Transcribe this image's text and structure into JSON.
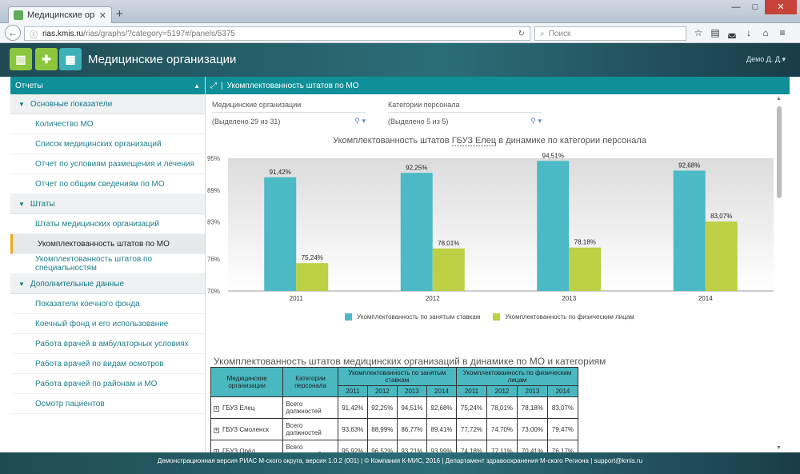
{
  "browser": {
    "tab_title": "Медицинские организации",
    "url_domain": "rias.kmis.ru",
    "url_path": "/rias/graphs/?category=5197#/panels/5375",
    "search_placeholder": "Поиск"
  },
  "app": {
    "title": "Медицинские организации",
    "user": "Демо Д. Д."
  },
  "sidebar": {
    "header": "Отчеты",
    "sections": [
      {
        "label": "Основные показатели",
        "items": [
          "Количество МО",
          "Список медицинских организаций",
          "Отчет по условиям размещения и лечения",
          "Отчет по общим сведениям по МО"
        ]
      },
      {
        "label": "Штаты",
        "items": [
          "Штаты медицинских организаций",
          "Укомплектованность штатов по МО",
          "Укомплектованность штатов по специальностям"
        ]
      },
      {
        "label": "Дополнительные данные",
        "items": [
          "Показатели коечного фонда",
          "Коечный фонд и его использование",
          "Работа врачей в амбулаторных условиях",
          "Работа врачей по видам осмотров",
          "Работа врачей по районам и МО",
          "Осмотр пациентов"
        ]
      }
    ]
  },
  "panel": {
    "title": "Укомплектованность штатов по МО",
    "filters": [
      {
        "label": "Медицинские организации",
        "value": "(Выделено 29 из 31)"
      },
      {
        "label": "Категории персонала",
        "value": "(Выделено 5 из 5)"
      }
    ]
  },
  "chart": {
    "title_before": "Укомплектованность штатов ",
    "title_link": "ГБУЗ Елец",
    "title_after": " в динамике по категории персонала"
  },
  "chart_data": {
    "type": "bar",
    "categories": [
      "2011",
      "2012",
      "2013",
      "2014"
    ],
    "series": [
      {
        "name": "Укомплектованность по занятым ставкам",
        "values": [
          91.42,
          92.25,
          94.51,
          92.68
        ],
        "labels": [
          "91,42%",
          "92,25%",
          "94,51%",
          "92,68%"
        ],
        "color": "#4bb9c6"
      },
      {
        "name": "Укомплектованность по физическим лицам",
        "values": [
          75.24,
          78.01,
          78.18,
          83.07
        ],
        "labels": [
          "75,24%",
          "78,01%",
          "78,18%",
          "83,07%"
        ],
        "color": "#bccf45"
      }
    ],
    "ylim": [
      70,
      95
    ],
    "yticks": [
      70,
      76,
      83,
      89,
      95
    ],
    "ytick_labels": [
      "70%",
      "76%",
      "83%",
      "89%",
      "95%"
    ],
    "grid": false,
    "legend": "bottom"
  },
  "table": {
    "title": "Укомплектованность штатов медицинских организаций в динамике по МО и категориям",
    "col_mo": "Медицинские организации",
    "col_cat": "Категории персонала",
    "group1": "Укомплектованность по занятым ставкам",
    "group2": "Укомплектованность по физическим лицам",
    "years": [
      "2011",
      "2012",
      "2013",
      "2014",
      "2011",
      "2012",
      "2013",
      "2014"
    ],
    "rows": [
      {
        "mo": "ГБУЗ Елец",
        "cat": "Всего должностей",
        "values": [
          "91,42%",
          "92,25%",
          "94,51%",
          "92,68%",
          "75,24%",
          "78,01%",
          "78,18%",
          "83,07%"
        ]
      },
      {
        "mo": "ГБУЗ Смоленск",
        "cat": "Всего должностей",
        "values": [
          "93,63%",
          "88,99%",
          "86,77%",
          "89,41%",
          "77,72%",
          "74,70%",
          "73,00%",
          "79,47%"
        ]
      },
      {
        "mo": "ГБУЗ Орёл",
        "cat": "Всего должностей",
        "values": [
          "95,92%",
          "96,52%",
          "93,21%",
          "93,99%",
          "74,18%",
          "77,11%",
          "70,41%",
          "76,17%"
        ]
      }
    ]
  },
  "footer": "Демонстрационная версия РИАС М-ского округа, версия 1.0.2 (001) | © Компания К-МИС, 2016 | Департамент здравоохранения М-ского Региона | support@kmis.ru"
}
